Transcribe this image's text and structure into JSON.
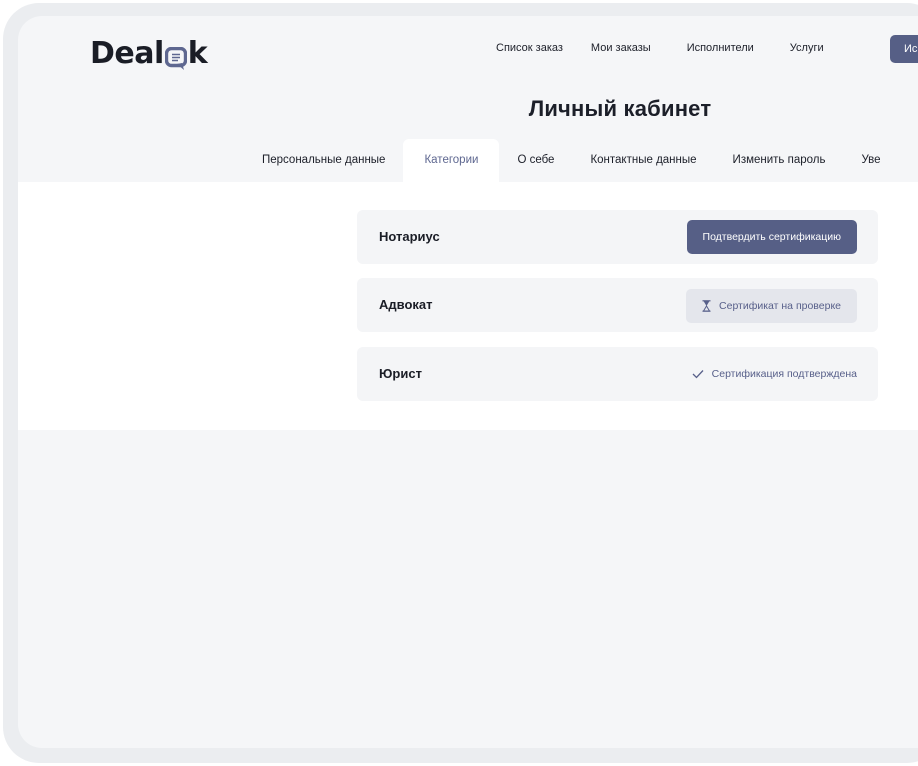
{
  "brand": {
    "logo_left": "Deal",
    "logo_right": "k",
    "logo_icon": "speech-bubble-o-icon"
  },
  "nav": {
    "items": [
      "Список заказ",
      "Мои заказы",
      "Исполнители",
      "Услуги"
    ],
    "search_button": "Искать"
  },
  "page": {
    "title": "Личный кабинет"
  },
  "tabs": [
    "Персональные данные",
    "Категории",
    "О себе",
    "Контактные данные",
    "Изменить пароль",
    "Уве"
  ],
  "active_tab": "Категории",
  "categories": [
    {
      "name": "Нотариус",
      "action": "Подтвердить сертификацию",
      "status": "unconfirmed"
    },
    {
      "name": "Адвокат",
      "action": "Сертификат на проверке",
      "status": "pending",
      "icon": "hourglass-icon"
    },
    {
      "name": "Юрист",
      "action": "Сертификация подтверждена",
      "status": "confirmed",
      "icon": "checkmark-icon"
    }
  ],
  "colors": {
    "accent": "#565f86",
    "accent_text": "#58608a",
    "page_bg": "#f5f6f8",
    "card_bg": "#f4f5f7"
  }
}
